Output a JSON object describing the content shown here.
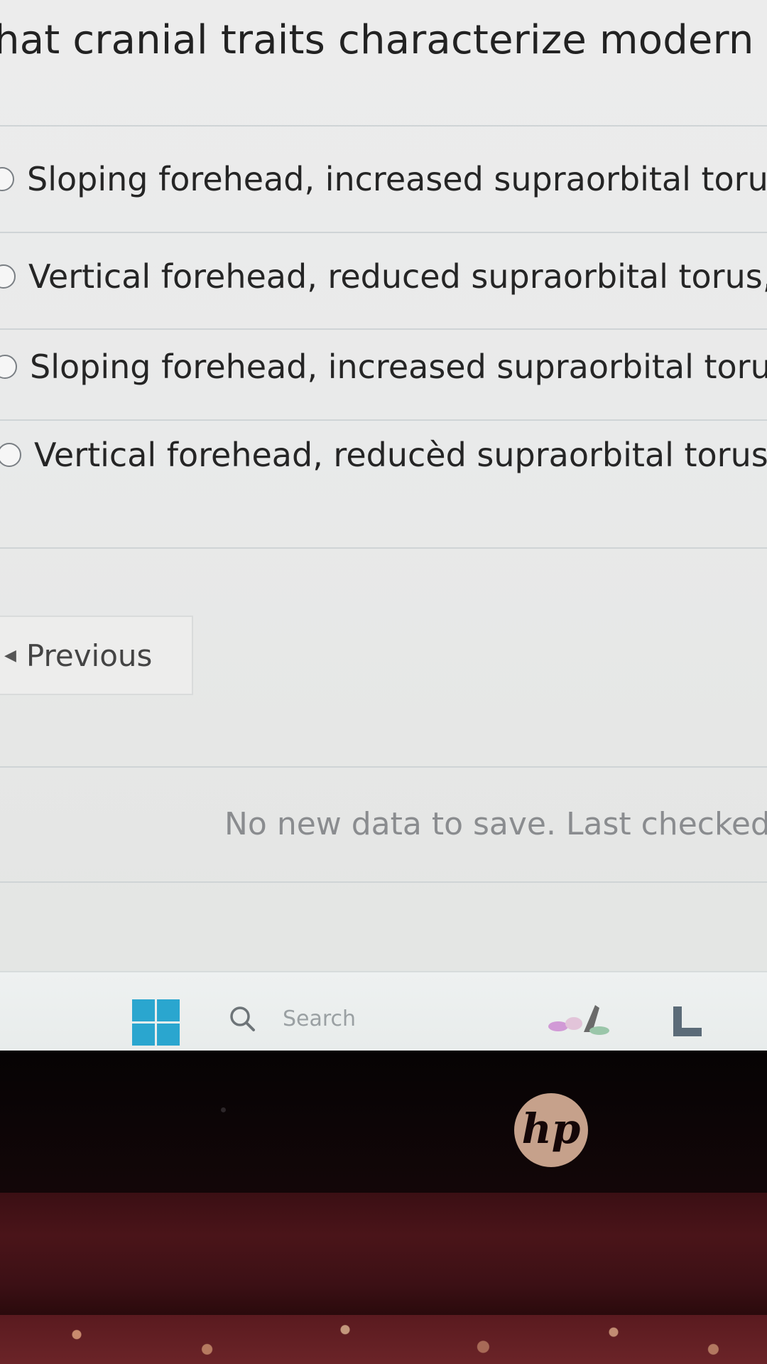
{
  "quiz": {
    "question": "hat cranial traits characterize modern human",
    "options": [
      {
        "label": "Sloping forehead, increased supraorbital torus, pre"
      },
      {
        "label": "Vertical forehead, reduced supraorbital torus, abse"
      },
      {
        "label": "Sloping forehead, increased supraorbital torus, pres"
      },
      {
        "label": "Vertical forehead, reducèd supraorbital torus, preser"
      }
    ],
    "previous_label": "Previous",
    "status": "No new data to save. Last checked at"
  },
  "taskbar": {
    "search_label": "Search",
    "icons": [
      "windows-start-icon",
      "search-icon",
      "tray-app-icon",
      "l-app-icon"
    ],
    "accent_color": "#2aa6cf"
  },
  "device": {
    "logo": "hp",
    "bezel_color": "#0a0405"
  }
}
